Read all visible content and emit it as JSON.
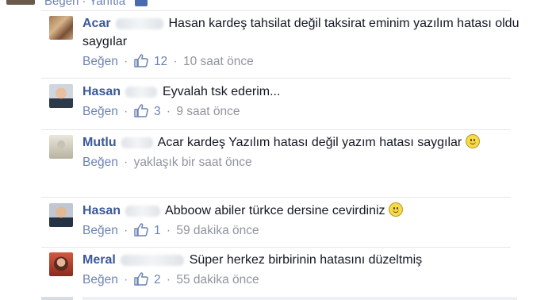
{
  "top": {
    "like_label": "Beğen",
    "dot": "·",
    "rest": "Yanıtla"
  },
  "comments": [
    {
      "author": "Acar",
      "text": "Hasan kardeş tahsilat değil taksirat eminim yazılım hatası oldu saygılar",
      "like_label": "Beğen",
      "like_count": "12",
      "time": "10 saat önce"
    },
    {
      "author": "Hasan",
      "text": "Eyvalah tsk ederim...",
      "like_label": "Beğen",
      "like_count": "3",
      "time": "9 saat önce"
    },
    {
      "author": "Mutlu",
      "text": "Acar kardeş Yazılım hatası değil yazım hatası saygılar",
      "like_label": "Beğen",
      "time": "yaklaşık bir saat önce"
    },
    {
      "author": "Hasan",
      "text": "Abboow abiler türkce dersine cevirdiniz",
      "like_label": "Beğen",
      "like_count": "1",
      "time": "59 dakika önce"
    },
    {
      "author": "Meral",
      "text": "Süper herkez birbirinin hatasını düzeltmiş",
      "like_label": "Beğen",
      "like_count": "2",
      "time": "55 dakika önce"
    }
  ],
  "separator": "·",
  "colors": {
    "author": "#3b5998",
    "link": "#6d84b4",
    "muted": "#90949c",
    "divider": "#e5e7ea"
  },
  "icons": {
    "like": "thumbs-up-icon",
    "emoji": "smiley-icon"
  }
}
